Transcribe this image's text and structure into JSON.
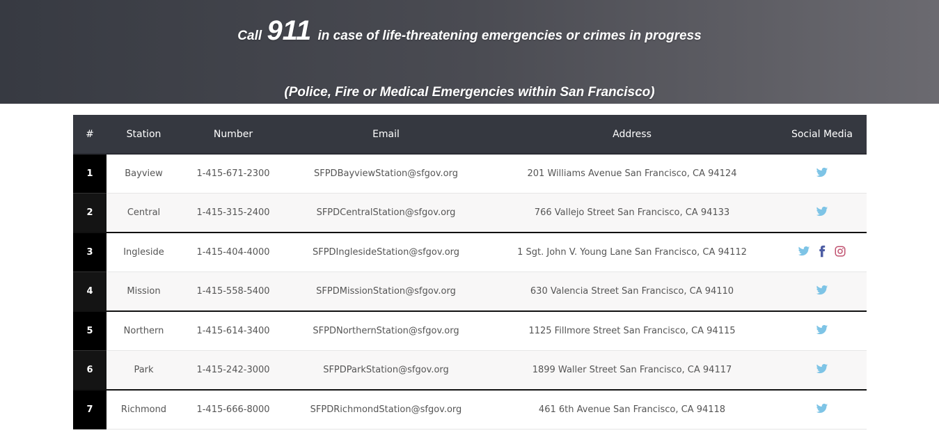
{
  "banner": {
    "line1_pre": "Call",
    "line1_big": "911",
    "line1_post": "in case of life-threatening emergencies or crimes in progress",
    "line2": "(Police, Fire or Medical Emergencies within San Francisco)"
  },
  "table": {
    "headers": [
      "#",
      "Station",
      "Number",
      "Email",
      "Address",
      "Social Media"
    ],
    "rows": [
      {
        "num": "1",
        "station": "Bayview",
        "number": "1-415-671-2300",
        "email": "SFPDBayviewStation@sfgov.org",
        "address": "201 Williams Avenue San Francisco, CA 94124",
        "social": [
          "twitter-icon"
        ]
      },
      {
        "num": "2",
        "station": "Central",
        "number": "1-415-315-2400",
        "email": "SFPDCentralStation@sfgov.org",
        "address": "766 Vallejo Street San Francisco, CA 94133",
        "social": [
          "twitter-icon"
        ]
      },
      {
        "num": "3",
        "station": "Ingleside",
        "number": "1-415-404-4000",
        "email": "SFPDInglesideStation@sfgov.org",
        "address": "1 Sgt. John V. Young Lane San Francisco, CA 94112",
        "social": [
          "twitter-icon",
          "facebook-icon",
          "instagram-icon"
        ]
      },
      {
        "num": "4",
        "station": "Mission",
        "number": "1-415-558-5400",
        "email": "SFPDMissionStation@sfgov.org",
        "address": "630 Valencia Street San Francisco, CA 94110",
        "social": [
          "twitter-icon"
        ]
      },
      {
        "num": "5",
        "station": "Northern",
        "number": "1-415-614-3400",
        "email": "SFPDNorthernStation@sfgov.org",
        "address": "1125 Fillmore Street San Francisco, CA 94115",
        "social": [
          "twitter-icon"
        ]
      },
      {
        "num": "6",
        "station": "Park",
        "number": "1-415-242-3000",
        "email": "SFPDParkStation@sfgov.org",
        "address": "1899 Waller Street San Francisco, CA 94117",
        "social": [
          "twitter-icon"
        ]
      },
      {
        "num": "7",
        "station": "Richmond",
        "number": "1-415-666-8000",
        "email": "SFPDRichmondStation@sfgov.org",
        "address": "461 6th Avenue San Francisco, CA 94118",
        "social": [
          "twitter-icon"
        ]
      }
    ]
  },
  "colors": {
    "twitter": "#7ec4e6",
    "facebook": "#4d5da4",
    "instagram": "#c0516f",
    "header_bg": "#353840",
    "number_cell_bg": "#000000"
  }
}
